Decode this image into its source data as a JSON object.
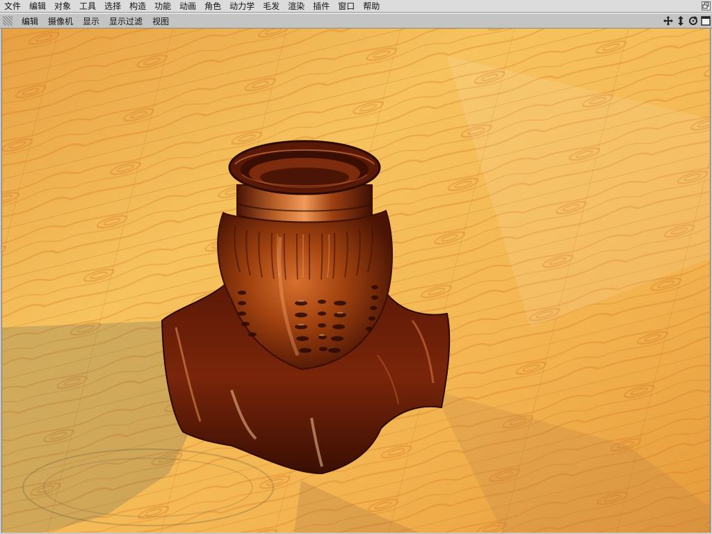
{
  "main_menu": {
    "items": [
      {
        "label": "文件"
      },
      {
        "label": "编辑"
      },
      {
        "label": "对象"
      },
      {
        "label": "工具"
      },
      {
        "label": "选择"
      },
      {
        "label": "构造"
      },
      {
        "label": "功能"
      },
      {
        "label": "动画"
      },
      {
        "label": "角色"
      },
      {
        "label": "动力学"
      },
      {
        "label": "毛发"
      },
      {
        "label": "渲染"
      },
      {
        "label": "插件"
      },
      {
        "label": "窗口"
      },
      {
        "label": "帮助"
      }
    ],
    "window_button_icon": "restore-window-icon"
  },
  "viewport_menu": {
    "items": [
      {
        "label": "编辑"
      },
      {
        "label": "摄像机"
      },
      {
        "label": "显示"
      },
      {
        "label": "显示过滤"
      },
      {
        "label": "视图"
      }
    ],
    "nav_icons": [
      "move-view-icon",
      "dolly-view-icon",
      "rotate-view-icon",
      "maximize-view-icon"
    ]
  },
  "scene": {
    "floor_color": "#f0b452",
    "floor_grain_color": "#d9781f",
    "object_color": "#6a1e08",
    "object_highlight": "#e87a3a"
  }
}
